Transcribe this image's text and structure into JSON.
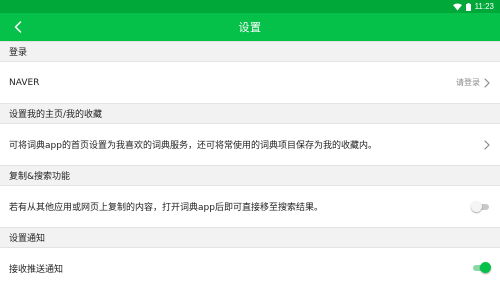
{
  "status_bar": {
    "time": "11:23",
    "wifi_icon": "wifi-icon",
    "battery_icon": "battery-icon"
  },
  "app_bar": {
    "title": "设置",
    "back_icon": "chevron-left-icon"
  },
  "sections": {
    "login": {
      "header": "登录",
      "row_label": "NAVER",
      "row_action": "请登录"
    },
    "home": {
      "header": "设置我的主页/我的收藏",
      "row_label": "可将词典app的首页设置为我喜欢的词典服务，还可将常使用的词典项目保存为我的收藏内。"
    },
    "copy_search": {
      "header": "复制&搜索功能",
      "row_label": "若有从其他应用或网页上复制的内容，打开词典app后即可直接移至搜索结果。",
      "toggle_on": false
    },
    "notification": {
      "header": "设置通知",
      "row_label": "接收推送通知",
      "toggle_on": true
    }
  },
  "colors": {
    "accent": "#05c149",
    "status_bar": "#00a83a",
    "section_bg": "#f2f2f2"
  }
}
